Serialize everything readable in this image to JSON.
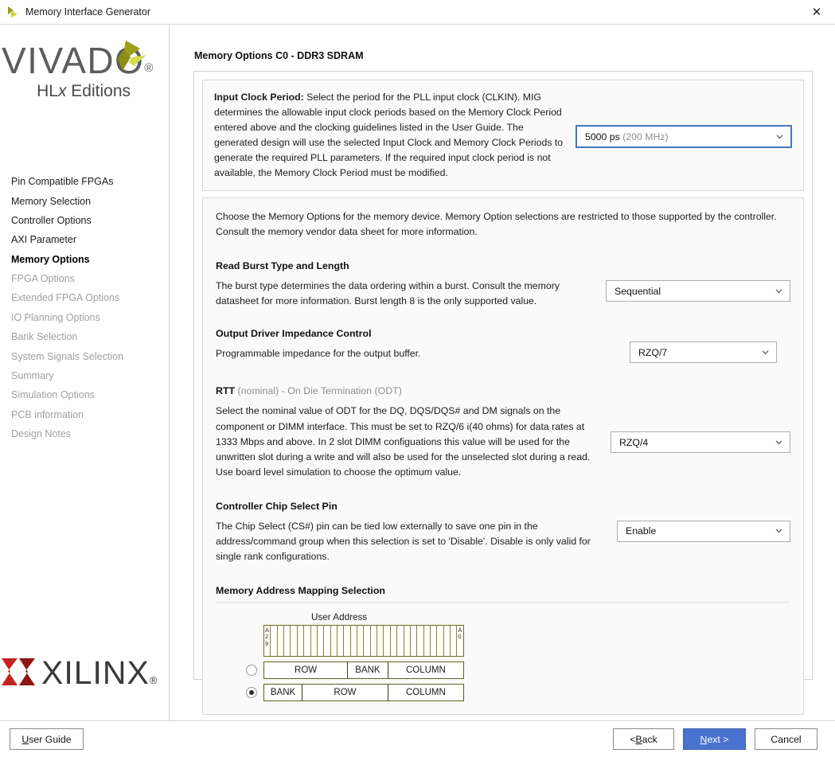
{
  "window": {
    "title": "Memory Interface Generator",
    "close_label": "✕",
    "app_icon": "vivado-logo-icon"
  },
  "sidebar": {
    "brand": {
      "name": "VIVADO",
      "registered": "®",
      "edition_prefix": "HL",
      "edition_italic": "x",
      "edition_suffix": " Editions"
    },
    "footer_logo": {
      "name": "XILINX",
      "registered": "®"
    },
    "items": [
      {
        "label": "Pin Compatible FPGAs",
        "state": "enabled"
      },
      {
        "label": "Memory Selection",
        "state": "enabled"
      },
      {
        "label": "Controller Options",
        "state": "enabled"
      },
      {
        "label": "AXI Parameter",
        "state": "enabled"
      },
      {
        "label": "Memory Options",
        "state": "active"
      },
      {
        "label": "FPGA Options",
        "state": "disabled"
      },
      {
        "label": "Extended FPGA Options",
        "state": "disabled"
      },
      {
        "label": "IO Planning Options",
        "state": "disabled"
      },
      {
        "label": "Bank Selection",
        "state": "disabled"
      },
      {
        "label": "System Signals Selection",
        "state": "disabled"
      },
      {
        "label": "Summary",
        "state": "disabled"
      },
      {
        "label": "Simulation Options",
        "state": "disabled"
      },
      {
        "label": "PCB information",
        "state": "disabled"
      },
      {
        "label": "Design Notes",
        "state": "disabled"
      }
    ]
  },
  "main": {
    "page_title": "Memory Options C0 - DDR3 SDRAM",
    "input_clock": {
      "label_bold": "Input Clock Period:",
      "description": " Select the period for the PLL input clock (CLKIN). MIG determines the allowable input clock periods based on the Memory Clock Period entered above and the clocking guidelines listed in the User Guide. The generated design will use the selected Input Clock and Memory Clock Periods to generate the required PLL parameters. If the required input clock period is not available, the Memory Clock Period must be modified.",
      "value": "5000 ps",
      "value_note": "(200 MHz)"
    },
    "intro": "Choose the Memory Options for the memory device. Memory Option selections are restricted to those supported by the controller. Consult the memory vendor data sheet for more information.",
    "read_burst": {
      "title": "Read Burst Type and Length",
      "description": "The burst type determines the data ordering within a burst. Consult the memory datasheet for more information. Burst length 8 is the only supported value.",
      "value": "Sequential"
    },
    "output_driver": {
      "title": "Output Driver Impedance Control",
      "description": "Programmable impedance for the output buffer.",
      "value": "RZQ/7"
    },
    "rtt": {
      "title_bold": "RTT",
      "title_gray": " (nominal) - On Die Termination (ODT)",
      "description": "Select the nominal value of ODT for the DQ, DQS/DQS# and DM signals on the component or DIMM interface. This must be set to RZQ/6 i(40 ohms) for data rates at 1333 Mbps and above. In 2 slot DIMM configuations this value will be used for the unwritten slot during a write and will also be used for the unselected slot during a read. Use board level simulation to choose the optimum value.",
      "value": "RZQ/4"
    },
    "chip_select": {
      "title": "Controller Chip Select Pin",
      "description": "The Chip Select (CS#) pin can be tied low externally to save one pin in the address/command group when this selection is set to 'Disable'. Disable is only valid for single rank configurations.",
      "value": "Enable"
    },
    "address_mapping": {
      "title": "Memory Address Mapping Selection",
      "user_address_label": "User Address",
      "bit_high_label": "A29",
      "bit_low_label": "A0",
      "bit_count": 30,
      "options": [
        {
          "selected": false,
          "segments": [
            {
              "label": "ROW",
              "weight": 42
            },
            {
              "label": "BANK",
              "weight": 20
            },
            {
              "label": "COLUMN",
              "weight": 38
            }
          ]
        },
        {
          "selected": true,
          "segments": [
            {
              "label": "BANK",
              "weight": 19
            },
            {
              "label": "ROW",
              "weight": 43
            },
            {
              "label": "COLUMN",
              "weight": 38
            }
          ]
        }
      ]
    }
  },
  "footer": {
    "user_guide": {
      "pre": "",
      "mnemonic": "U",
      "post": "ser Guide"
    },
    "back": {
      "pre": "< ",
      "mnemonic": "B",
      "post": "ack"
    },
    "next": {
      "pre": "",
      "mnemonic": "N",
      "post": "ext >"
    },
    "cancel": {
      "pre": "",
      "mnemonic": "",
      "post": "Cancel"
    }
  },
  "colors": {
    "accent_blue": "#4a72cf",
    "focus_blue": "#4577c4",
    "vivado_green": "#cdd43a",
    "xilinx_red": "#c3231f",
    "grid_olive": "#8a8528"
  }
}
